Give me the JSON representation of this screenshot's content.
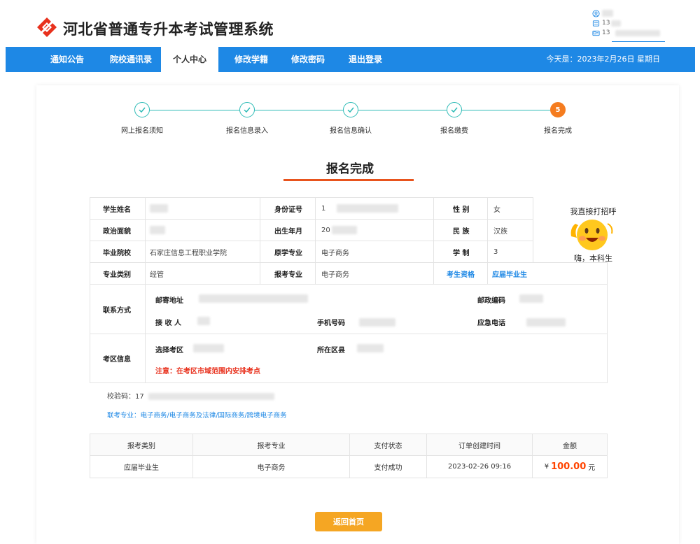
{
  "header": {
    "title": "河北省普通专升本考试管理系统",
    "user_line1": "",
    "user_line2": "13",
    "user_line3": "13"
  },
  "nav": {
    "items": [
      {
        "label": "通知公告"
      },
      {
        "label": "院校通讯录"
      },
      {
        "label": "个人中心"
      },
      {
        "label": "修改学籍"
      },
      {
        "label": "修改密码"
      },
      {
        "label": "退出登录"
      }
    ],
    "active": "个人中心",
    "today": "今天是：2023年2月26日 星期日"
  },
  "stepper": {
    "steps": [
      {
        "label": "网上报名须知",
        "status": "done"
      },
      {
        "label": "报名信息录入",
        "status": "done"
      },
      {
        "label": "报名信息确认",
        "status": "done"
      },
      {
        "label": "报名缴费",
        "status": "done"
      },
      {
        "label": "报名完成",
        "status": "current",
        "number": "5"
      }
    ]
  },
  "done_title": "报名完成",
  "info": {
    "name_label": "学生姓名",
    "name_value": "",
    "id_label": "身份证号",
    "id_value": "1",
    "gender_label": "性 别",
    "gender_value": "女",
    "political_label": "政治面貌",
    "political_value": "",
    "birth_label": "出生年月",
    "birth_value": "20",
    "ethnic_label": "民 族",
    "ethnic_value": "汉族",
    "school_label": "毕业院校",
    "school_value": "石家庄信息工程职业学院",
    "orig_major_label": "原学专业",
    "orig_major_value": "电子商务",
    "system_label": "学 制",
    "system_value": "3",
    "major_cat_label": "专业类别",
    "major_cat_value": "经管",
    "apply_major_label": "报考专业",
    "apply_major_value": "电子商务",
    "qual_label": "考生资格",
    "qual_value": "应届毕业生",
    "contact_label": "联系方式",
    "mail_label": "邮寄地址",
    "postcode_label": "邮政编码",
    "receiver_label": "接 收 人",
    "phone_label": "手机号码",
    "emergency_label": "应急电话",
    "exam_area_label": "考区信息",
    "select_area_label": "选择考区",
    "district_label": "所在区县",
    "notice": "注意：在考区市域范围内安排考点"
  },
  "checkcode": "校验码：17",
  "combo": "联考专业：电子商务/电子商务及法律/国际商务/跨境电子商务",
  "order": {
    "headers": [
      "报考类别",
      "报考专业",
      "支付状态",
      "订单创建时间",
      "金额"
    ],
    "row": {
      "category": "应届毕业生",
      "major": "电子商务",
      "status": "支付成功",
      "time": "2023-02-26 09:16",
      "currency": "¥",
      "amount": "100.00",
      "unit": "元"
    }
  },
  "back_button": "返回首页",
  "sticker": {
    "top": "我直接打招呼",
    "bottom": "嗨，本科生"
  },
  "colors": {
    "nav_blue": "#1e88e5",
    "step_teal": "#2dbbb6",
    "step_current": "#f57c1f",
    "accent_red": "#e8531d",
    "button_orange": "#f5a623",
    "amount_red": "#ff4400"
  }
}
